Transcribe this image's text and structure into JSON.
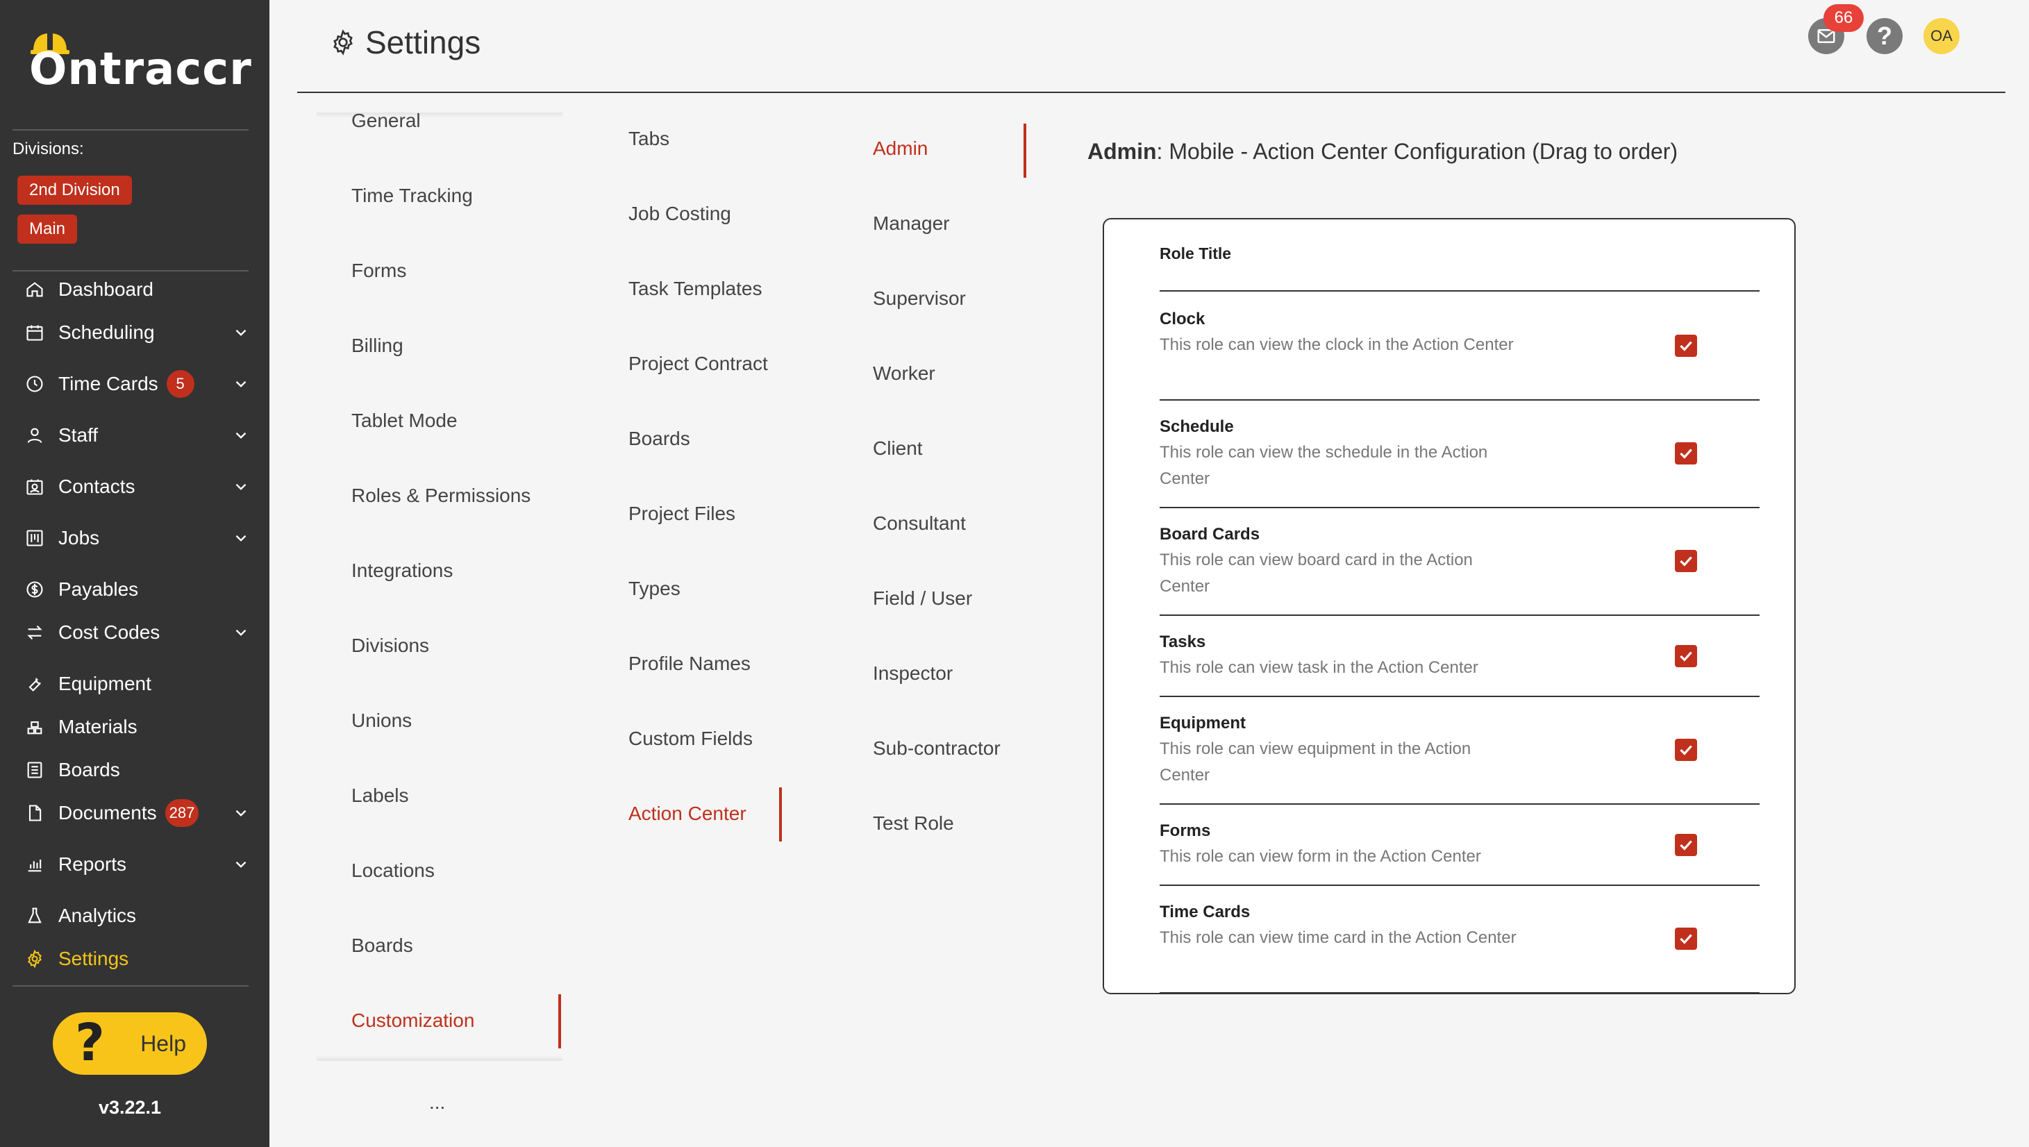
{
  "app": {
    "brand": "Ontraccr",
    "accent": "#c0301c",
    "highlight": "#f5c518"
  },
  "sidebar": {
    "divisions_label": "Divisions:",
    "divisions": [
      "2nd Division",
      "Main"
    ],
    "items": [
      {
        "label": "Dashboard",
        "icon": "home-icon"
      },
      {
        "label": "Scheduling",
        "icon": "calendar-icon"
      },
      {
        "label": "Time Cards",
        "icon": "clock-icon",
        "badge": "5"
      },
      {
        "label": "Staff",
        "icon": "person-icon"
      },
      {
        "label": "Contacts",
        "icon": "contacts-icon"
      },
      {
        "label": "Jobs",
        "icon": "jobs-icon"
      },
      {
        "label": "Payables",
        "icon": "dollar-icon"
      },
      {
        "label": "Cost Codes",
        "icon": "swap-icon"
      },
      {
        "label": "Equipment",
        "icon": "wrench-icon"
      },
      {
        "label": "Materials",
        "icon": "materials-icon"
      },
      {
        "label": "Boards",
        "icon": "boards-icon"
      },
      {
        "label": "Documents",
        "icon": "document-icon",
        "badge": "287"
      },
      {
        "label": "Reports",
        "icon": "bar-chart-icon"
      },
      {
        "label": "Analytics",
        "icon": "flask-icon"
      },
      {
        "label": "Settings",
        "icon": "gear-icon",
        "active": true
      }
    ],
    "help_label": "Help",
    "version": "v3.22.1"
  },
  "header": {
    "title": "Settings",
    "mail_badge": "66",
    "help_icon": "?",
    "avatar_initials": "OA"
  },
  "menu1": {
    "items": [
      "General",
      "Time Tracking",
      "Forms",
      "Billing",
      "Tablet Mode",
      "Roles & Permissions",
      "Integrations",
      "Divisions",
      "Unions",
      "Labels",
      "Locations",
      "Boards",
      "Customization"
    ],
    "selected": "Customization",
    "more": "..."
  },
  "menu2": {
    "items": [
      "Tabs",
      "Job Costing",
      "Task Templates",
      "Project Contract",
      "Boards",
      "Project Files",
      "Types",
      "Profile Names",
      "Custom Fields",
      "Action Center"
    ],
    "selected": "Action Center"
  },
  "menu3": {
    "items": [
      "Admin",
      "Manager",
      "Supervisor",
      "Worker",
      "Client",
      "Consultant",
      "Field / User",
      "Inspector",
      "Sub-contractor",
      "Test Role"
    ],
    "selected": "Admin"
  },
  "panel": {
    "heading_role": "Admin",
    "heading_rest": ": Mobile - Action Center Configuration (Drag to order)",
    "column_title": "Role Title",
    "rows": [
      {
        "name": "Clock",
        "desc": "This role can view the clock in the Action Center",
        "checked": true
      },
      {
        "name": "Schedule",
        "desc": "This role can view the schedule in the Action Center",
        "checked": true
      },
      {
        "name": "Board Cards",
        "desc": "This role can view board card in the Action Center",
        "checked": true
      },
      {
        "name": "Tasks",
        "desc": "This role can view task in the Action Center",
        "checked": true
      },
      {
        "name": "Equipment",
        "desc": "This role can view equipment in the Action Center",
        "checked": true
      },
      {
        "name": "Forms",
        "desc": "This role can view form in the Action Center",
        "checked": true
      },
      {
        "name": "Time Cards",
        "desc": "This role can view time card in the Action Center",
        "checked": true
      }
    ]
  }
}
